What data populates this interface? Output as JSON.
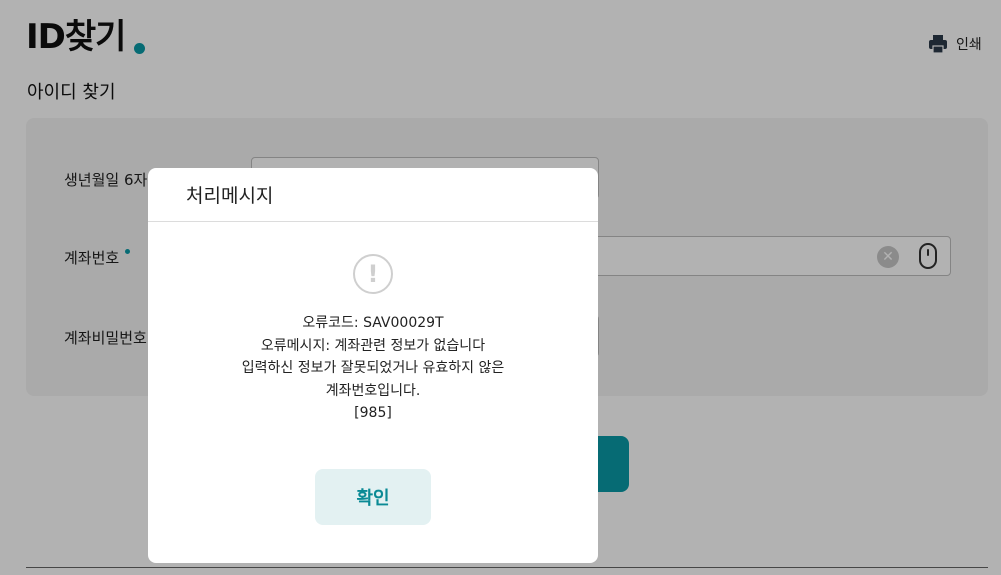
{
  "page": {
    "title": "ID찾기",
    "section_title": "아이디 찾기",
    "print_label": "인쇄",
    "accent_color": "#0a9aa6"
  },
  "form": {
    "birth_label": "생년월일 6자리",
    "account_label": "계좌번호",
    "password_label": "계좌비밀번호",
    "clear_glyph": "✕"
  },
  "modal": {
    "title": "처리메시지",
    "alert_glyph": "!",
    "lines": [
      "오류코드: SAV00029T",
      "오류메시지: 계좌관련 정보가 없습니다",
      "입력하신 정보가 잘못되었거나 유효하지 않은",
      "계좌번호입니다.",
      "[985]"
    ],
    "confirm_label": "확인",
    "confirm_bg": "#e3f1f2",
    "confirm_color": "#0a8a95"
  }
}
